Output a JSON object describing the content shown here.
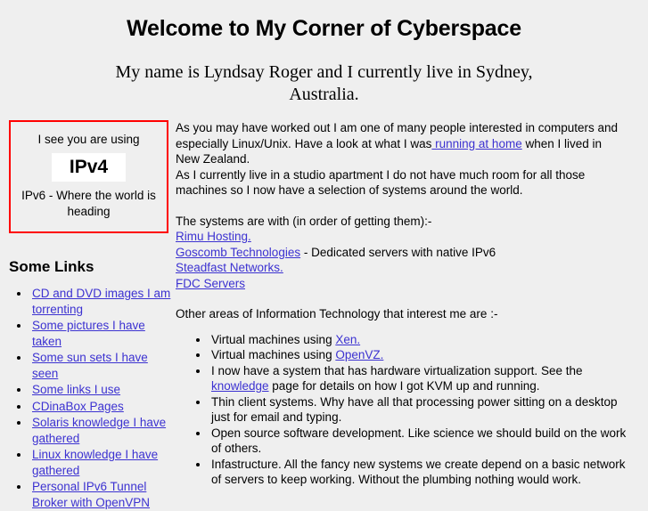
{
  "header": {
    "title": "Welcome to My Corner of Cyberspace",
    "subtitle": "My name is Lyndsay Roger and I currently live in Sydney, Australia."
  },
  "ip_box": {
    "border_color": "#ff0000",
    "lead_text": "I see you are using",
    "version": "IPv4",
    "tail_text": "IPv6 - Where the world is heading"
  },
  "sidebar": {
    "heading": "Some Links",
    "items": [
      {
        "label": "CD and DVD images I am torrenting"
      },
      {
        "label": "Some pictures I have taken"
      },
      {
        "label": "Some sun sets I have seen"
      },
      {
        "label": "Some links I use"
      },
      {
        "label": "CDinaBox Pages"
      },
      {
        "label": "Solaris knowledge I have gathered"
      },
      {
        "label": "Linux knowledge I have gathered"
      },
      {
        "label": "Personal IPv6 Tunnel Broker with OpenVPN"
      }
    ]
  },
  "content": {
    "intro_part1": "As you may have worked out I am one of many people interested in computers and especially Linux/Unix. Have a look at what I was",
    "intro_link": " running at home",
    "intro_part2": " when I lived in New Zealand.",
    "paragraph2": "As I currently live in a studio apartment I do not have much room for all those machines so I now have a selection of systems around the world.",
    "systems_intro": "The systems are with (in order of getting them):-",
    "systems": [
      {
        "link": "Rimu Hosting.",
        "suffix": ""
      },
      {
        "link": "Goscomb Technologies",
        "suffix": " - Dedicated servers with native IPv6"
      },
      {
        "link": "Steadfast Networks.",
        "suffix": ""
      },
      {
        "link": "FDC Servers",
        "suffix": ""
      }
    ],
    "interests_intro": "Other areas of Information Technology that interest me are :-",
    "interests": [
      {
        "prefix": "Virtual machines using ",
        "link": "Xen.",
        "suffix": ""
      },
      {
        "prefix": "Virtual machines using ",
        "link": "OpenVZ.",
        "suffix": ""
      },
      {
        "prefix": "I now have a system that has hardware virtualization support. See the ",
        "link": "knowledge",
        "suffix": " page for details on how I got KVM up and running."
      },
      {
        "prefix": "Thin client systems. Why have all that processing power sitting on a desktop just for email and typing.",
        "link": "",
        "suffix": ""
      },
      {
        "prefix": "Open source software development. Like science we should build on the work of others.",
        "link": "",
        "suffix": ""
      },
      {
        "prefix": "Infastructure. All the fancy new systems we create depend on a basic network of servers to keep working. Without the plumbing nothing would work.",
        "link": "",
        "suffix": ""
      }
    ]
  },
  "colors": {
    "page_background": "#efefef",
    "link": "#3c32d1",
    "text": "#000000",
    "ip_box_border": "#ff0000",
    "ip_version_background": "#ffffff"
  }
}
